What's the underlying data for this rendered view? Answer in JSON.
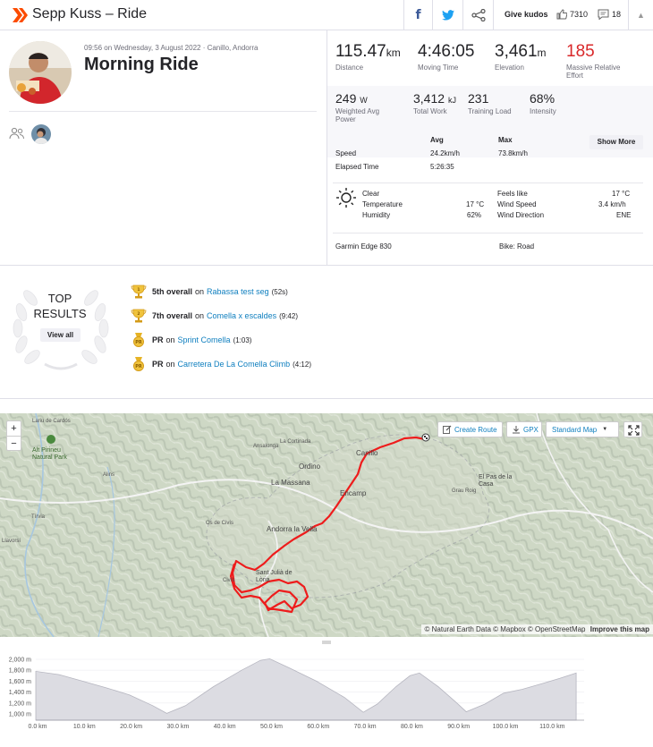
{
  "header": {
    "title": "Sepp Kuss – Ride",
    "give_kudos": "Give kudos",
    "kudos_count": "7310",
    "comment_count": "18"
  },
  "activity": {
    "meta": "09:56 on Wednesday, 3 August 2022 · Canillo, Andorra",
    "title": "Morning Ride"
  },
  "stats": {
    "distance": {
      "value": "115.47",
      "unit": "km",
      "label": "Distance"
    },
    "moving_time": {
      "value": "4:46:05",
      "label": "Moving Time"
    },
    "elevation": {
      "value": "3,461",
      "unit": "m",
      "label": "Elevation"
    },
    "relative_effort": {
      "value": "185",
      "label_1": "Massive Relative",
      "label_2": "Effort"
    },
    "power": {
      "value": "249",
      "unit": "W",
      "label_1": "Weighted Avg",
      "label_2": "Power"
    },
    "total_work": {
      "value": "3,412",
      "unit": "kJ",
      "label": "Total Work"
    },
    "training_load": {
      "value": "231",
      "label": "Training Load"
    },
    "intensity": {
      "value": "68%",
      "label": "Intensity"
    }
  },
  "details": {
    "avg_header": "Avg",
    "max_header": "Max",
    "show_more": "Show More",
    "speed_label": "Speed",
    "speed_avg": "24.2km/h",
    "speed_max": "73.8km/h",
    "elapsed_label": "Elapsed Time",
    "elapsed_value": "5:26:35"
  },
  "weather": {
    "condition": "Clear",
    "temperature_label": "Temperature",
    "temperature_value": "17 °C",
    "humidity_label": "Humidity",
    "humidity_value": "62%",
    "feels_like_label": "Feels like",
    "feels_like_value": "17 °C",
    "wind_speed_label": "Wind Speed",
    "wind_speed_value": "3.4 km/h",
    "wind_dir_label": "Wind Direction",
    "wind_dir_value": "ENE",
    "device": "Garmin Edge 830",
    "bike": "Bike: Road"
  },
  "top_results": {
    "title_1": "TOP",
    "title_2": "RESULTS",
    "view_all": "View all",
    "items": [
      {
        "rank": "5th overall",
        "on": "on",
        "segment": "Rabassa test seg",
        "time": "(52s)",
        "icon": "trophy-gold-icon"
      },
      {
        "rank": "7th overall",
        "on": "on",
        "segment": "Comella x escaldes",
        "time": "(9:42)",
        "icon": "trophy-gold-icon"
      },
      {
        "rank": "PR",
        "on": "on",
        "segment": "Sprint Comella",
        "time": "(1:03)",
        "icon": "pr-medal-icon"
      },
      {
        "rank": "PR",
        "on": "on",
        "segment": "Carretera De La Comella Climb",
        "time": "(4:12)",
        "icon": "pr-medal-icon"
      }
    ]
  },
  "map": {
    "zoom_in": "+",
    "zoom_out": "−",
    "create_route": "Create Route",
    "gpx": "GPX",
    "map_type": "Standard Map",
    "attribution": "© Natural Earth Data © Mapbox © OpenStreetMap",
    "improve": "Improve this map",
    "labels": {
      "park": "Alt Pirineu Natural Park",
      "lariu": "Lariu de Cardós",
      "canillo": "Canillo",
      "encamp": "Encamp",
      "massana": "La Massana",
      "ordino": "Ordino",
      "andorra": "Andorra la Vella",
      "santjulia": "Sant Julià de Lòria",
      "pas": "El Pas de la Casa",
      "cormadia": "La Cortinada",
      "ansalonga": "Ansalonga",
      "alins": "Alins",
      "tirvia": "Tírvia",
      "llavorsi": "Llavorsí",
      "civis": "Civís",
      "ossa": "Os de Civís",
      "grau": "Grau Roig"
    }
  },
  "elevation": {
    "y_ticks": [
      "2,000 m",
      "1,800 m",
      "1,600 m",
      "1,400 m",
      "1,200 m",
      "1,000 m"
    ],
    "x_ticks": [
      "0.0 km",
      "10.0 km",
      "20.0 km",
      "30.0 km",
      "40.0 km",
      "50.0 km",
      "60.0 km",
      "70.0 km",
      "80.0 km",
      "90.0 km",
      "100.0 km",
      "110.0 km"
    ]
  },
  "colors": {
    "brand": "#fc4c02",
    "link": "#0f7fbf",
    "effort": "#d9282a",
    "route": "#ee1c1c"
  }
}
